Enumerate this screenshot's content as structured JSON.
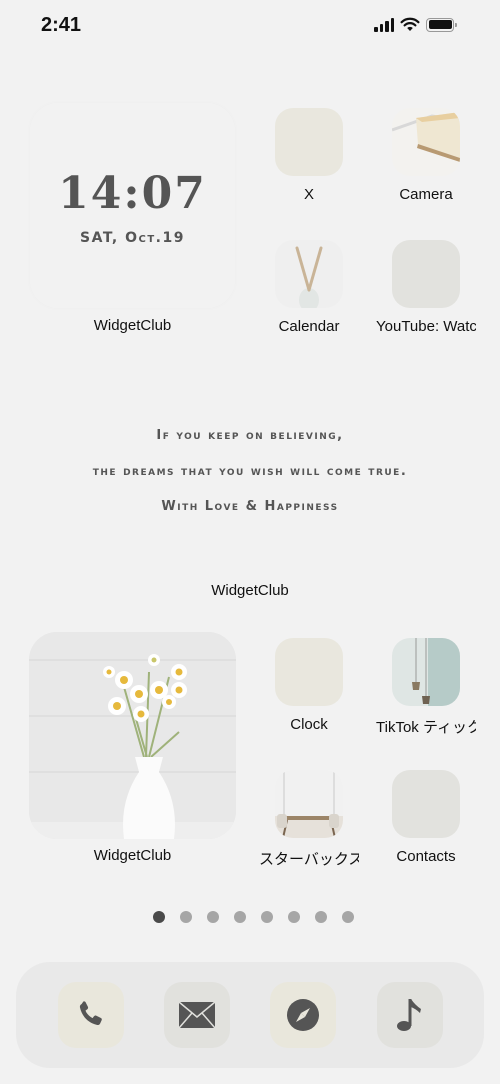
{
  "status_bar": {
    "time": "2:41",
    "signal_icon": "cellular-signal-icon",
    "wifi_icon": "wifi-icon",
    "battery_icon": "battery-icon"
  },
  "widgets": {
    "clock": {
      "time": "14:07",
      "date": "SAT, Oct.19",
      "label": "WidgetClub"
    },
    "quote": {
      "lines": [
        "If you keep on believing,",
        "the dreams that you wish will come true.",
        "With Love & Happiness"
      ],
      "label": "WidgetClub"
    },
    "photo": {
      "label": "WidgetClub",
      "image": "daisies-in-white-vase"
    }
  },
  "apps": [
    {
      "label": "X",
      "bg": "#e9e7de"
    },
    {
      "label": "Camera",
      "image": "cheesecake"
    },
    {
      "label": "Calendar",
      "image": "dried-grass-vase"
    },
    {
      "label": "YouTube: Watch",
      "bg": "#e2e2de"
    },
    {
      "label": "Clock",
      "bg": "#e9e7de"
    },
    {
      "label": "TikTok ティック",
      "image": "pendant-lamps"
    },
    {
      "label": "スターバックス",
      "image": "dining-table"
    },
    {
      "label": "Contacts",
      "bg": "#e2e2de"
    }
  ],
  "page_dots": {
    "count": 8,
    "active": 0
  },
  "dock": [
    {
      "name": "phone",
      "icon": "phone-icon",
      "bg": "#e9e7dc"
    },
    {
      "name": "mail",
      "icon": "mail-icon",
      "bg": "#e1e1dd"
    },
    {
      "name": "safari",
      "icon": "compass-icon",
      "bg": "#e9e7dc"
    },
    {
      "name": "music",
      "icon": "music-note-icon",
      "bg": "#e1e1dd"
    }
  ],
  "colors": {
    "background": "#f2f2f2",
    "text_dark": "#555555",
    "icon_glyph": "#555555"
  }
}
